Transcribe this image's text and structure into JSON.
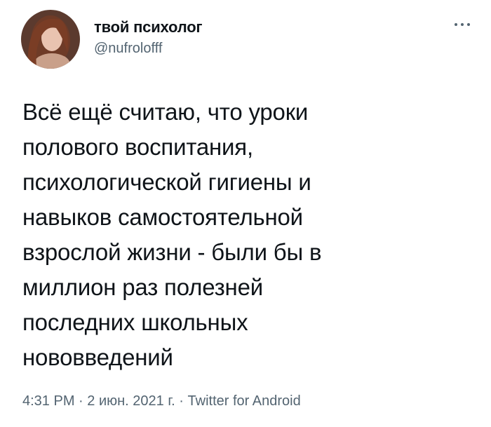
{
  "author": {
    "display_name": "твой психолог",
    "handle": "@nufrolofff"
  },
  "tweet": {
    "text": "Всё ещё считаю, что уроки\nполового воспитания,\nпсихологической гигиены и\nнавыков самостоятельной\nвзрослой жизни - были бы в\nмиллион раз полезней\nпоследних школьных\nнововведений"
  },
  "meta": {
    "time": "4:31 PM",
    "separator": " · ",
    "date": "2 июн. 2021 г.",
    "source": "Twitter for Android"
  },
  "icons": {
    "more": "more-horizontal-icon"
  },
  "colors": {
    "text_primary": "#0f1419",
    "text_secondary": "#536471",
    "background": "#ffffff"
  }
}
